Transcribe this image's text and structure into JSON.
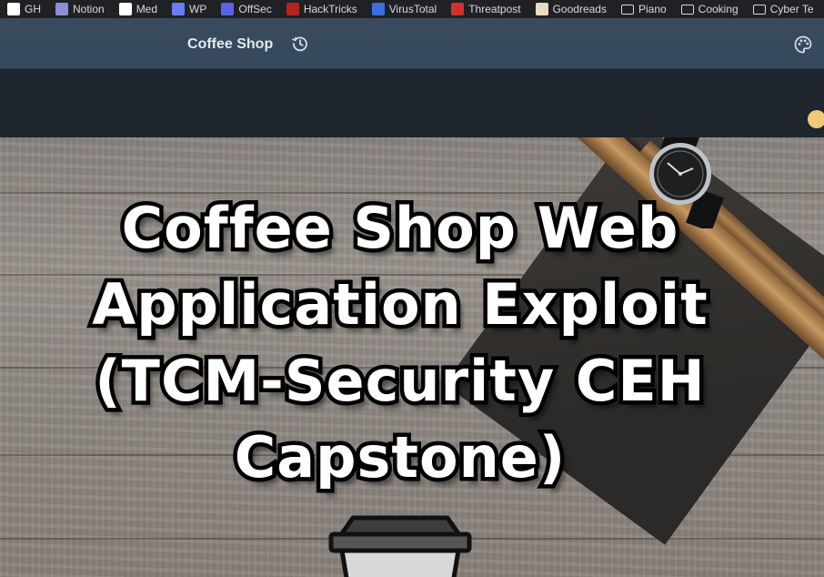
{
  "bookmarks": [
    {
      "label": "GH",
      "icon": "github-icon",
      "color": "#ffffff"
    },
    {
      "label": "Notion",
      "icon": "notion-icon",
      "color": "#8a8fd8"
    },
    {
      "label": "Med",
      "icon": "medium-icon",
      "color": "#ffffff"
    },
    {
      "label": "WP",
      "icon": "wordpress-icon",
      "color": "#6b7cf0"
    },
    {
      "label": "OffSec",
      "icon": "offsec-icon",
      "color": "#5a62e8"
    },
    {
      "label": "HackTricks",
      "icon": "hacktricks-icon",
      "color": "#b3231f"
    },
    {
      "label": "VirusTotal",
      "icon": "virustotal-icon",
      "color": "#3b6fe0"
    },
    {
      "label": "Threatpost",
      "icon": "threatpost-icon",
      "color": "#d0312d"
    },
    {
      "label": "Goodreads",
      "icon": "goodreads-icon",
      "color": "#e9dcc3"
    },
    {
      "label": "Piano",
      "icon": "folder-icon",
      "color": ""
    },
    {
      "label": "Cooking",
      "icon": "folder-icon",
      "color": ""
    },
    {
      "label": "Cyber Te",
      "icon": "folder-icon",
      "color": ""
    }
  ],
  "navbar": {
    "site_title": "Coffee Shop",
    "history_icon": "history-icon",
    "theme_icon": "palette-icon"
  },
  "hero": {
    "title_line1": "Coffee Shop Web",
    "title_line2": "Application Exploit",
    "title_line3": "(TCM-Security CEH",
    "title_line4": "Capstone)"
  },
  "colors": {
    "navbar": "#34495e",
    "strip": "#1e252d",
    "accent_dot": "#f2c879"
  }
}
